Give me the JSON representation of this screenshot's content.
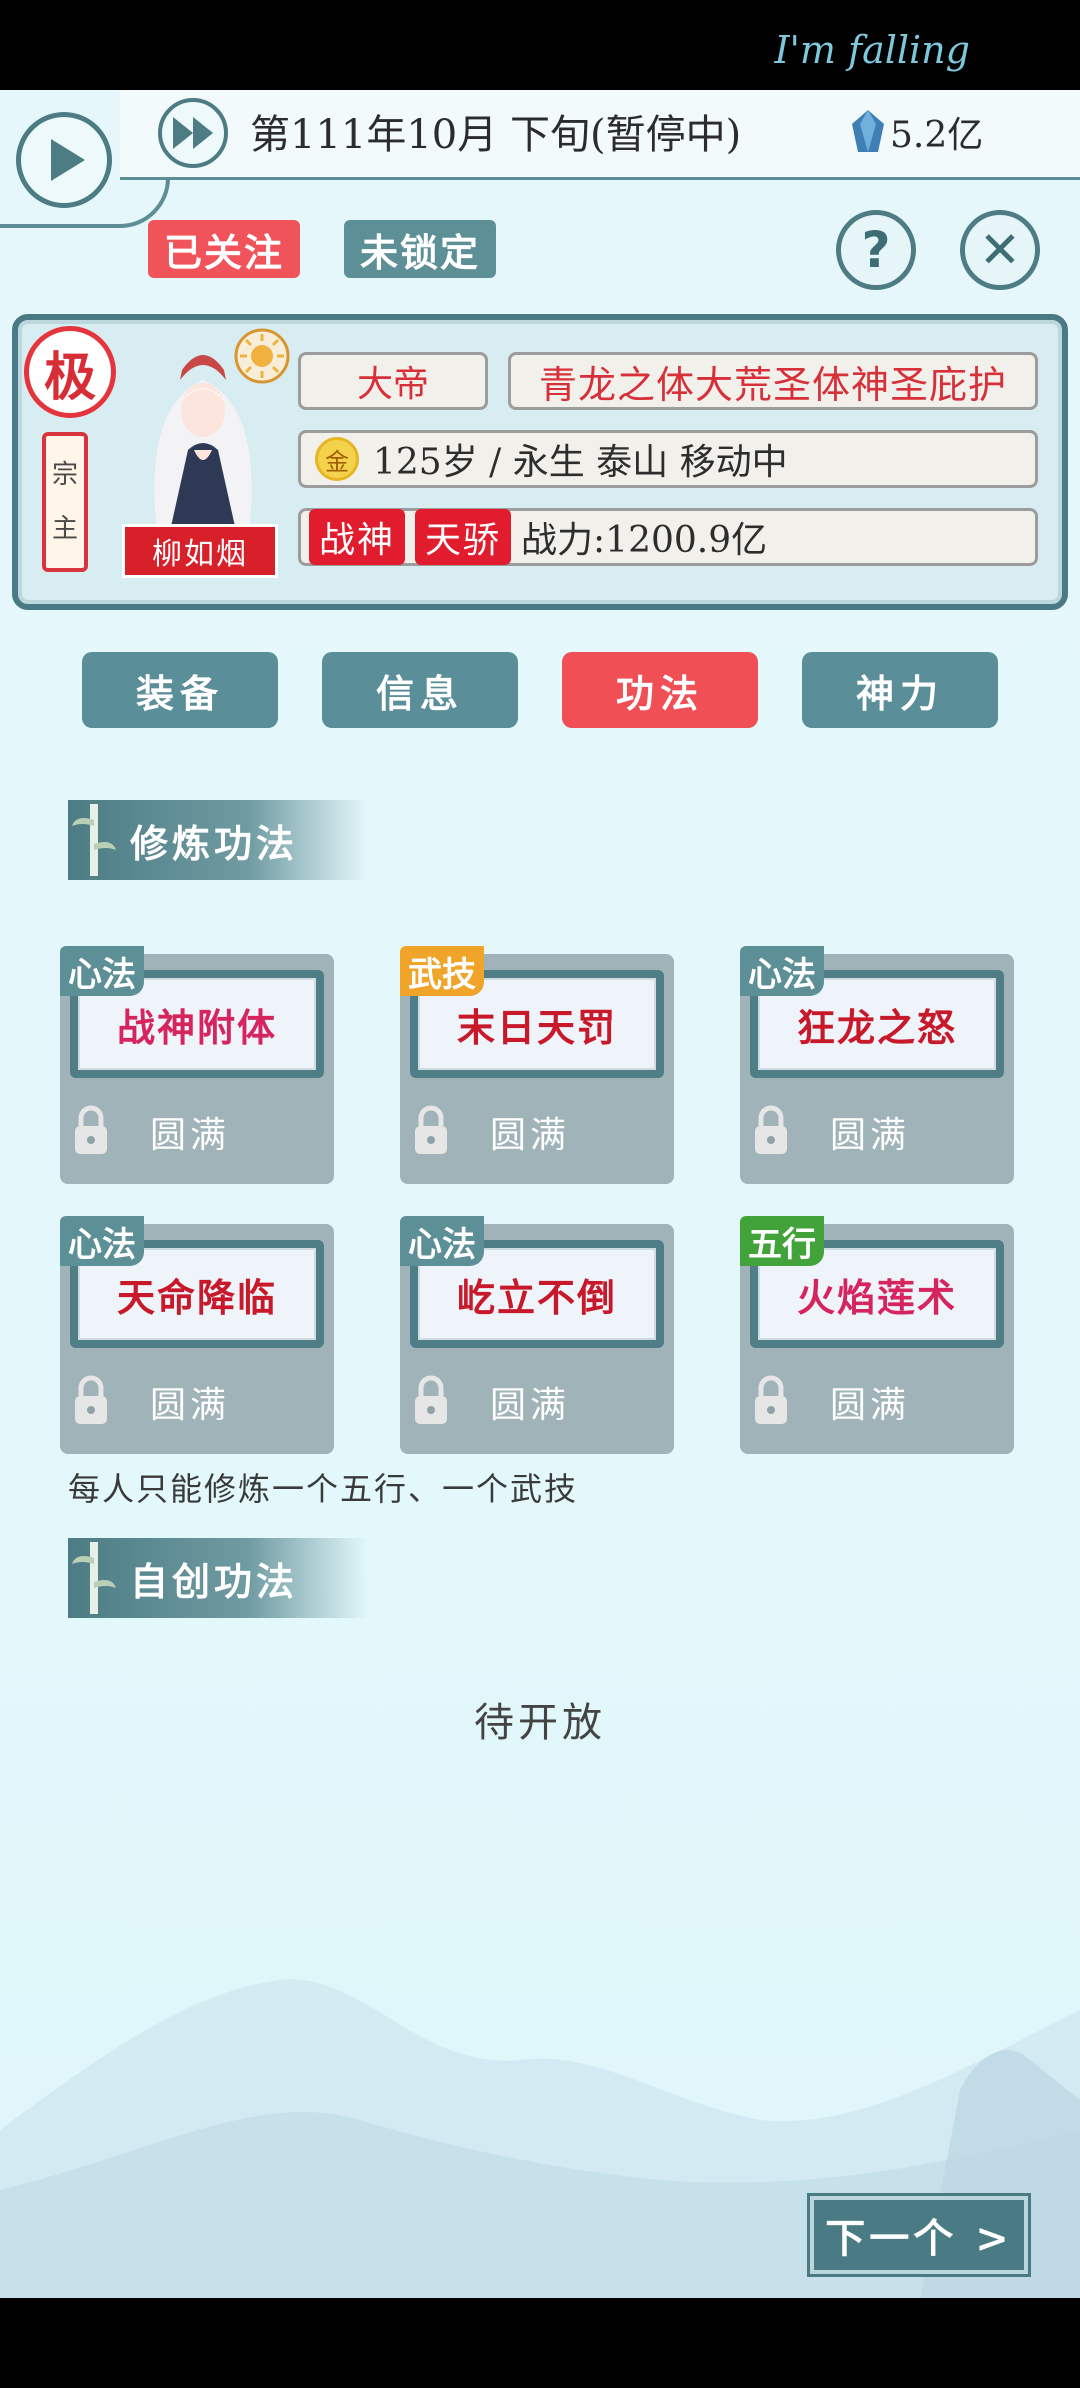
{
  "status_bar": {
    "text": "I'm falling"
  },
  "topbar": {
    "date": "第111年10月 下旬(暂停中)",
    "gem_count": "5.2亿"
  },
  "actions": {
    "follow_label": "已关注",
    "lock_label": "未锁定",
    "help_symbol": "?",
    "close_symbol": "✕"
  },
  "character": {
    "rank_badge": "极",
    "title_tag": [
      "宗",
      "主"
    ],
    "name": "柳如烟",
    "realm": "大帝",
    "bloodline": "青龙之体大荒圣体神圣庇护",
    "element": "金",
    "stats": "125岁 / 永生   泰山   移动中",
    "badges": [
      "战神",
      "天骄"
    ],
    "power": "战力:1200.9亿"
  },
  "tabs": [
    {
      "label": "装备",
      "active": false
    },
    {
      "label": "信息",
      "active": false
    },
    {
      "label": "功法",
      "active": true
    },
    {
      "label": "神力",
      "active": false
    }
  ],
  "sections": {
    "cultivation": "修炼功法",
    "custom": "自创功法"
  },
  "skills": [
    {
      "type": "心法",
      "name": "战神附体",
      "status": "圆满",
      "name_color": "#d6245e"
    },
    {
      "type": "武技",
      "name": "末日天罚",
      "status": "圆满",
      "name_color": "#c8192a"
    },
    {
      "type": "心法",
      "name": "狂龙之怒",
      "status": "圆满",
      "name_color": "#c8192a"
    },
    {
      "type": "心法",
      "name": "天命降临",
      "status": "圆满",
      "name_color": "#c8192a"
    },
    {
      "type": "心法",
      "name": "屹立不倒",
      "status": "圆满",
      "name_color": "#c8192a"
    },
    {
      "type": "五行",
      "name": "火焰莲术",
      "status": "圆满",
      "name_color": "#d6245e"
    }
  ],
  "note": "每人只能修炼一个五行、一个武技",
  "pending": "待开放",
  "next_button": "下一个 >",
  "colors": {
    "accent_red": "#f04f55",
    "teal": "#5a8e98",
    "background": "#e3f8fb"
  }
}
